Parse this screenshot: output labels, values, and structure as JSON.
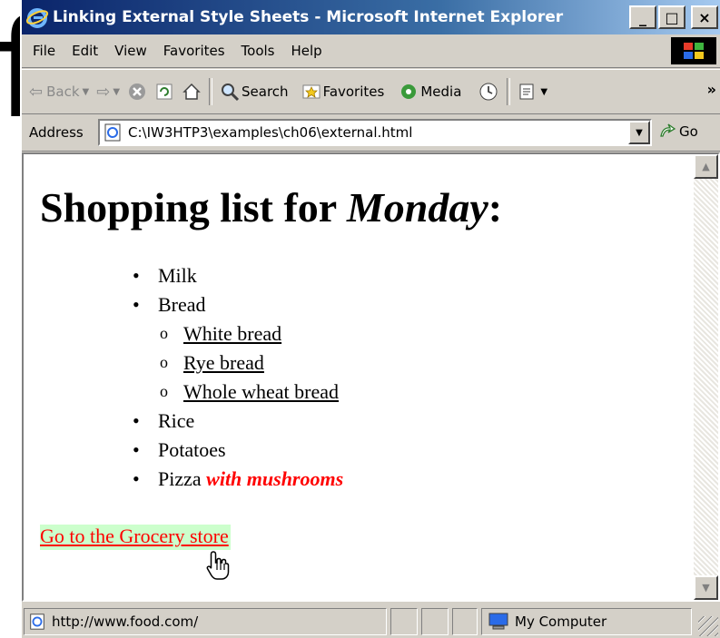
{
  "window": {
    "title": "Linking External Style Sheets - Microsoft Internet Explorer",
    "minimize": "_",
    "maximize": "□",
    "close": "×"
  },
  "menu": [
    "File",
    "Edit",
    "View",
    "Favorites",
    "Tools",
    "Help"
  ],
  "toolbar": {
    "back": "Back",
    "search": "Search",
    "favorites": "Favorites",
    "media": "Media",
    "more": "»"
  },
  "address": {
    "label": "Address",
    "value": "C:\\IW3HTP3\\examples\\ch06\\external.html",
    "go": "Go"
  },
  "page": {
    "heading_prefix": "Shopping list for ",
    "heading_day": "Monday",
    "heading_suffix": ":",
    "items": {
      "milk": "Milk",
      "bread": "Bread",
      "bread_types": [
        "White bread",
        "Rye bread",
        "Whole wheat bread"
      ],
      "rice": "Rice",
      "potatoes": "Potatoes",
      "pizza": "Pizza",
      "pizza_extra": "with mushrooms"
    },
    "store_link": "Go to the Grocery store"
  },
  "status": {
    "url": "http://www.food.com/",
    "zone": "My Computer"
  },
  "colors": {
    "title_bar": "#0a246a",
    "chrome": "#d4d0c8",
    "emphasis": "#ff0000",
    "link_highlight": "#ccffcc"
  }
}
